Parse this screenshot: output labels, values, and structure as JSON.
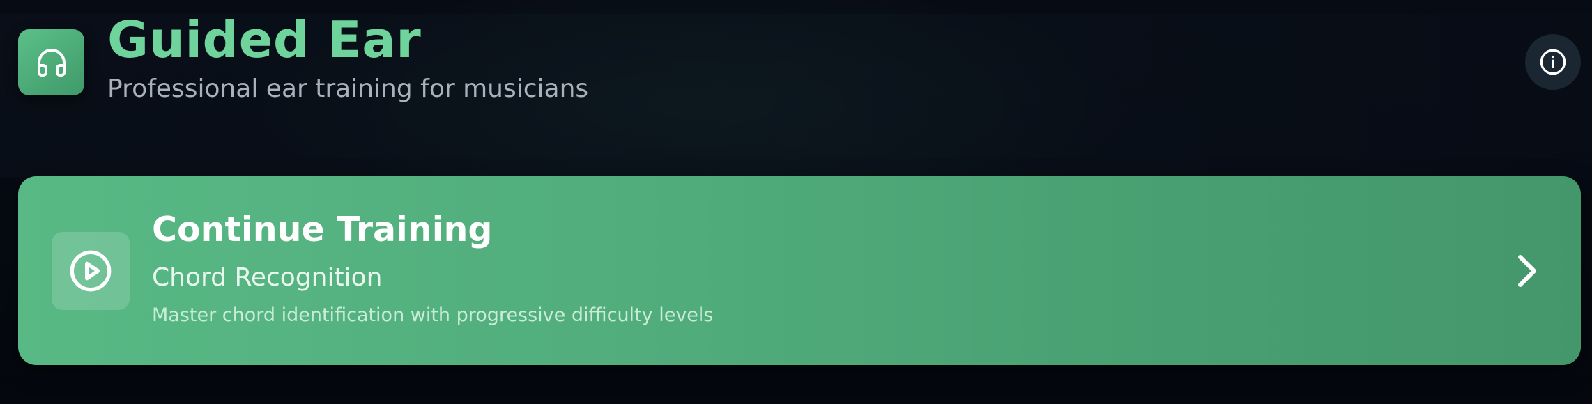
{
  "header": {
    "title": "Guided Ear",
    "subtitle": "Professional ear training for musicians",
    "logo_icon": "headphones-icon",
    "info_icon": "info-icon"
  },
  "continue_card": {
    "title": "Continue Training",
    "subtitle": "Chord Recognition",
    "description": "Master chord identification with progressive difficulty levels",
    "play_icon": "play-circle-icon",
    "chevron_icon": "chevron-right-icon"
  },
  "colors": {
    "background": "#050810",
    "accent": "#6fd39c",
    "card_start": "#58b985",
    "card_end": "#44976b",
    "subtitle_text": "#a9b1bc",
    "info_button_bg": "#1b2633"
  }
}
